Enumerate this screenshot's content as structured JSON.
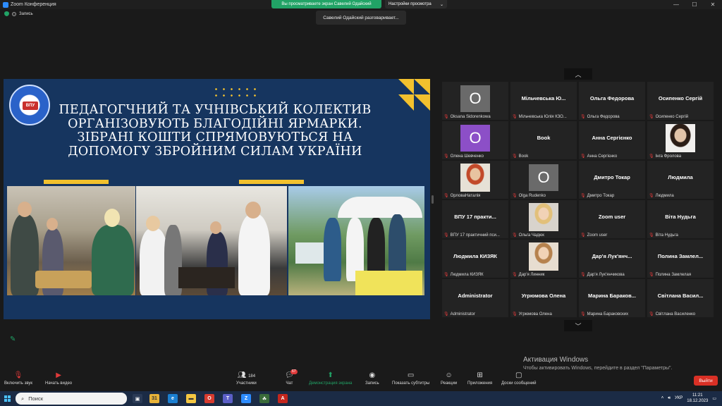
{
  "window": {
    "title": "Zoom Конференция",
    "share_status": "Вы просматриваете экран Савелий Одайский",
    "view_options": "Настройки просмотра",
    "controls": [
      "—",
      "☐",
      "✕"
    ]
  },
  "recording": {
    "label": "Запись"
  },
  "toast": "Савелий Одайский разговаривает...",
  "slide": {
    "title_lines": [
      "Педагогчний та учнівський колектив",
      "організовують благодійні ярмарки.",
      "Зібрані кошти спрямовуються на",
      "допомогу Збройним силам України"
    ],
    "logo_text": "ВПУ"
  },
  "gallery": {
    "tiles": [
      {
        "big": "",
        "avatar": "O",
        "avatar_color": "#6a6a6a",
        "name": "Oksana Sidorenkowa"
      },
      {
        "big": "Мільчевська Ю...",
        "name": "Мільчевська Юлія КЗО..."
      },
      {
        "big": "Ольга Федорова",
        "name": "Ольга Федорова"
      },
      {
        "big": "Осипенко Сергій",
        "name": "Осипенко Сергій"
      },
      {
        "big": "",
        "avatar": "O",
        "avatar_color": "#8c4fc7",
        "name": "Олена Шевченко"
      },
      {
        "big": "Book",
        "name": "Book"
      },
      {
        "big": "Анна Сергієнко",
        "name": "Анна Сергієнко"
      },
      {
        "big": "",
        "photo": "woman-dark",
        "name": "Інга Фролова"
      },
      {
        "big": "",
        "photo": "woman-red",
        "name": "ОрловаНаталія"
      },
      {
        "big": "",
        "avatar": "O",
        "avatar_color": "#6a6a6a",
        "name": "Olga Rudenko"
      },
      {
        "big": "Дмитро Токар",
        "name": "Дмитро Токар"
      },
      {
        "big": "Людмила",
        "name": "Людмила"
      },
      {
        "big": "ВПУ 17 практи...",
        "name": "ВПУ 17 практичний пси..."
      },
      {
        "big": "",
        "photo": "woman-light",
        "name": "Ольга Чадюк"
      },
      {
        "big": "Zoom user",
        "name": "Zoom user"
      },
      {
        "big": "Віта Нудьга",
        "name": "Віта Нудьга"
      },
      {
        "big": "Людмила КИЗЯК",
        "name": "Людмила КИЗЯК"
      },
      {
        "big": "",
        "photo": "girl",
        "name": "Дар'я Линник"
      },
      {
        "big": "Дар'я  Лук'янч...",
        "name": "Дар'я Лук'янчикова"
      },
      {
        "big": "Полина Замлел...",
        "name": "Полина Замлелая"
      },
      {
        "big": "Administrator",
        "name": "Administrator"
      },
      {
        "big": "Угрюмова Олена",
        "name": "Угрюмова Олена"
      },
      {
        "big": "Марина Бараков...",
        "name": "Марина Бараковских"
      },
      {
        "big": "Світлана Васил...",
        "name": "Світлана Василенко"
      }
    ]
  },
  "watermark": {
    "title": "Активация Windows",
    "subtitle": "Чтобы активировать Windows, перейдите в раздел \"Параметры\"."
  },
  "toolbar": {
    "unmute": "Включить звук",
    "start_video": "Начать видео",
    "participants": "Участники",
    "participants_count": "184",
    "chat": "Чат",
    "chat_badge": "67",
    "share": "Демонстрация экрана",
    "record": "Запись",
    "captions": "Показать субтитры",
    "reactions": "Реакции",
    "apps": "Приложения",
    "whiteboards": "Доски сообщений",
    "leave": "Выйти"
  },
  "taskbar": {
    "search": "Поиск",
    "lang": "УКР",
    "time": "11:21",
    "date": "18.12.2023"
  }
}
